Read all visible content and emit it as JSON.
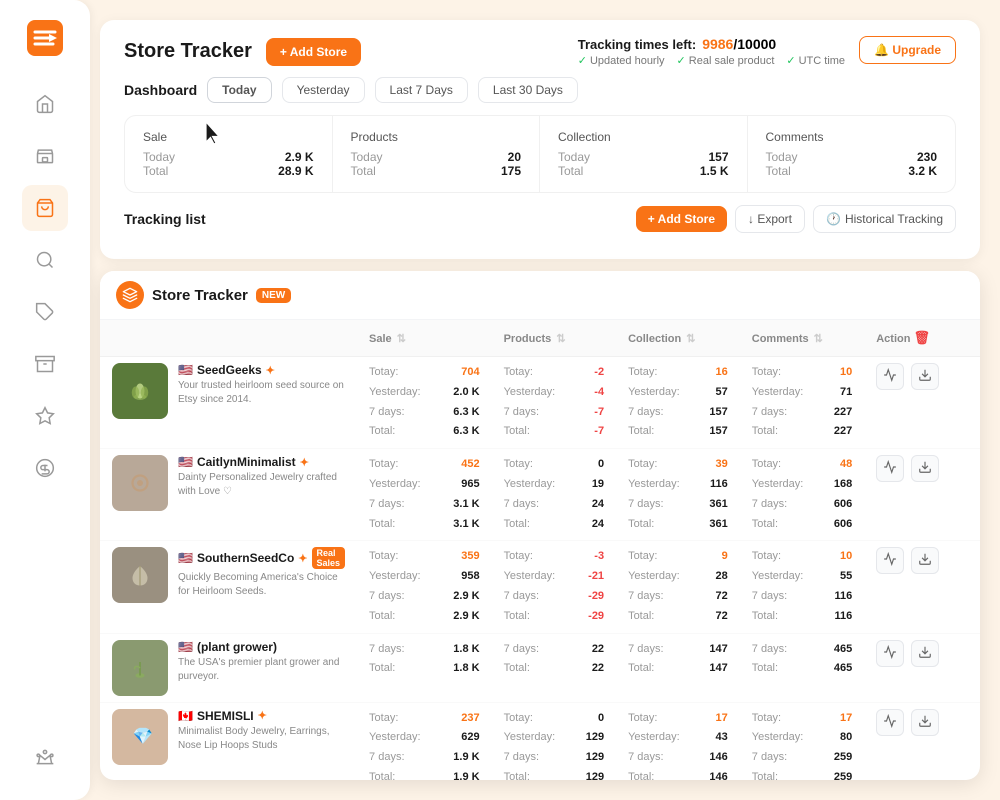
{
  "app": {
    "title": "Store Tracker",
    "add_store_label": "+ Add Store",
    "upgrade_label": "🔔 Upgrade",
    "tracking": {
      "label": "Tracking times left:",
      "used": "9986",
      "total": "10000",
      "meta": [
        "Updated hourly",
        "Real sale product",
        "UTC time"
      ]
    }
  },
  "dashboard": {
    "label": "Dashboard",
    "tabs": [
      "Today",
      "Yesterday",
      "Last 7 Days",
      "Last 30 Days"
    ],
    "active_tab": "Today",
    "stats": [
      {
        "label": "Sale",
        "today_label": "Today",
        "today_val": "2.9 K",
        "total_label": "Total",
        "total_val": "28.9 K"
      },
      {
        "label": "Products",
        "today_label": "Today",
        "today_val": "20",
        "total_label": "Total",
        "total_val": "175"
      },
      {
        "label": "Collection",
        "today_label": "Today",
        "today_val": "157",
        "total_label": "Total",
        "total_val": "1.5 K"
      },
      {
        "label": "Comments",
        "today_label": "Today",
        "today_val": "230",
        "total_label": "Total",
        "total_val": "3.2 K"
      }
    ]
  },
  "tracking_list": {
    "label": "Tracking list",
    "add_store_label": "+ Add Store",
    "export_label": "↓ Export",
    "historical_label": "Historical Tracking"
  },
  "popup": {
    "title": "Store Tracker",
    "badge": "NEW"
  },
  "table": {
    "columns": [
      "",
      "Sale",
      "Products",
      "Collection",
      "Comments",
      "Action"
    ],
    "delete_icon": "🗑",
    "rows": [
      {
        "name": "SeedGeeks",
        "flag": "🇺🇸",
        "verified": true,
        "real_sales": false,
        "description": "Your trusted heirloom seed source on Etsy since 2014.",
        "thumb_type": "seedgeeks",
        "thumb_icon": "🌿",
        "sale": {
          "today": "704",
          "yesterday": "2.0 K",
          "days7": "6.3 K",
          "total": "6.3 K"
        },
        "products": {
          "today": "-2",
          "yesterday": "-4",
          "days7": "-7",
          "total": "-7"
        },
        "collection": {
          "today": "16",
          "yesterday": "57",
          "days7": "157",
          "total": "157"
        },
        "comments": {
          "today": "10",
          "yesterday": "71",
          "days7": "227",
          "total": "227"
        },
        "sale_color": "orange",
        "products_color": "red",
        "collection_color": "orange",
        "comments_color": "orange"
      },
      {
        "name": "CaitlynMinimalist",
        "flag": "🇺🇸",
        "verified": true,
        "real_sales": false,
        "description": "Dainty Personalized Jewelry crafted with Love ♡",
        "thumb_type": "caitlyn",
        "thumb_icon": "💍",
        "sale": {
          "today": "452",
          "yesterday": "965",
          "days7": "3.1 K",
          "total": "3.1 K"
        },
        "products": {
          "today": "0",
          "yesterday": "19",
          "days7": "24",
          "total": "24"
        },
        "collection": {
          "today": "39",
          "yesterday": "116",
          "days7": "361",
          "total": "361"
        },
        "comments": {
          "today": "48",
          "yesterday": "168",
          "days7": "606",
          "total": "606"
        },
        "sale_color": "orange",
        "products_color": "dark",
        "collection_color": "orange",
        "comments_color": "orange"
      },
      {
        "name": "SouthernSeedCo",
        "flag": "🇺🇸",
        "verified": true,
        "real_sales": true,
        "description": "Quickly Becoming America&#39;s Choice for Heirloom Seeds.",
        "thumb_type": "southern",
        "thumb_icon": "🌾",
        "sale": {
          "today": "359",
          "yesterday": "958",
          "days7": "2.9 K",
          "total": "2.9 K"
        },
        "products": {
          "today": "-3",
          "yesterday": "-21",
          "days7": "-29",
          "total": "-29"
        },
        "collection": {
          "today": "9",
          "yesterday": "28",
          "days7": "72",
          "total": "72"
        },
        "comments": {
          "today": "10",
          "yesterday": "55",
          "days7": "116",
          "total": "116"
        },
        "sale_color": "orange",
        "products_color": "red",
        "collection_color": "orange",
        "comments_color": "orange"
      },
      {
        "name": "(plant grower)",
        "flag": "🇺🇸",
        "verified": false,
        "real_sales": false,
        "description": "The USA's premier plant grower and purveyor.",
        "thumb_type": "last",
        "thumb_icon": "🌱",
        "sale": {
          "today": "",
          "yesterday": "",
          "days7": "1.8 K",
          "total": "1.8 K"
        },
        "products": {
          "today": "",
          "yesterday": "",
          "days7": "22",
          "total": "22"
        },
        "collection": {
          "today": "",
          "yesterday": "",
          "days7": "147",
          "total": "147"
        },
        "comments": {
          "today": "",
          "yesterday": "",
          "days7": "465",
          "total": "465"
        },
        "sale_color": "orange",
        "products_color": "dark",
        "collection_color": "dark",
        "comments_color": "dark"
      },
      {
        "name": "SHEMISLI",
        "flag": "🇨🇦",
        "verified": true,
        "real_sales": false,
        "description": "Minimalist Body Jewelry, Earrings, Nose Lip Hoops Studs",
        "thumb_type": "shemisli",
        "thumb_icon": "💎",
        "sale": {
          "today": "237",
          "yesterday": "629",
          "days7": "1.9 K",
          "total": "1.9 K"
        },
        "products": {
          "today": "0",
          "yesterday": "129",
          "days7": "129",
          "total": "129"
        },
        "collection": {
          "today": "17",
          "yesterday": "43",
          "days7": "146",
          "total": "146"
        },
        "comments": {
          "today": "17",
          "yesterday": "80",
          "days7": "259",
          "total": "259"
        },
        "sale_color": "orange",
        "products_color": "dark",
        "collection_color": "orange",
        "comments_color": "orange"
      }
    ]
  },
  "sidebar": {
    "items": [
      {
        "name": "home",
        "icon": "home"
      },
      {
        "name": "store",
        "icon": "store"
      },
      {
        "name": "bag",
        "icon": "bag"
      },
      {
        "name": "search",
        "icon": "search"
      },
      {
        "name": "tag",
        "icon": "tag"
      },
      {
        "name": "box",
        "icon": "box"
      },
      {
        "name": "star",
        "icon": "star"
      },
      {
        "name": "dollar",
        "icon": "dollar"
      },
      {
        "name": "crown",
        "icon": "crown"
      }
    ]
  }
}
